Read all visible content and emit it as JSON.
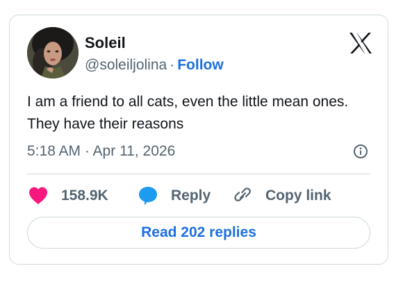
{
  "author": {
    "name": "Soleil",
    "handle": "@soleiljolina",
    "separator": "·",
    "follow_label": "Follow"
  },
  "tweet": {
    "text": "I am a friend to all cats, even the little mean ones. They have their reasons",
    "timestamp": "5:18 AM · Apr 11, 2026"
  },
  "actions": {
    "likes": "158.9K",
    "reply_label": "Reply",
    "copy_link_label": "Copy link"
  },
  "read_replies_label": "Read 202 replies",
  "icons": {
    "brand": "x-logo-icon",
    "info": "info-icon",
    "like": "heart-icon",
    "reply": "speech-bubble-icon",
    "copy": "link-icon"
  },
  "colors": {
    "heart": "#f91880",
    "bubble": "#1d9bf0",
    "link_blue": "#1d6fe0",
    "muted": "#536471",
    "border": "#cfd9de"
  }
}
